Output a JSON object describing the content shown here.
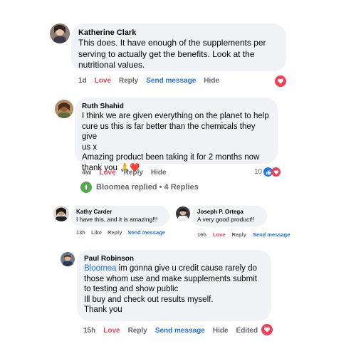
{
  "comments": [
    {
      "author": "Katherine Clark",
      "text": "This does. It have enough of the supplements per\nserving to actually get the benefits. Look at the\nnutritional values.",
      "time": "1d",
      "love": "Love",
      "reply": "Reply",
      "send": "Send message",
      "hide": "Hide",
      "reaction_icon": "heart-icon"
    },
    {
      "author": "Ruth Shahid",
      "text": "I think we are given everything on the planet to help\ncure us this is far better than the chemicals they give\nus x\nAmazing product been taking it for 2 months now\nthank you 🙏❤️",
      "time": "4w",
      "love": "Love",
      "reply": "Reply",
      "hide": "Hide",
      "reaction_count": "10",
      "reaction_icons": [
        "like-icon",
        "heart-icon"
      ]
    },
    {
      "author": "Kathy Carder",
      "text": "I have this, and it is amazing!!!",
      "time": "13h",
      "like": "Like",
      "reply": "Reply",
      "send": "Send message"
    },
    {
      "author": "Joseph P. Ortega",
      "text": "A very good product!!",
      "time": "16h",
      "love": "Love",
      "reply": "Reply",
      "send": "Send message"
    },
    {
      "author": "Paul Robinson",
      "mention": "Bloomea",
      "text": " im gonna give u credit cause rarely do\nthose whom use and make supplements submit\nto testing and show public\nIll buy and check out results myself.\nThank you",
      "time": "15h",
      "love": "Love",
      "reply": "Reply",
      "send": "Send message",
      "hide": "Hide",
      "edited": "Edited",
      "reaction_icon": "heart-icon"
    }
  ],
  "replies_summary": "Bloomea replied • 4 Replies",
  "colors": {
    "bubble": "#f0f2f5",
    "love": "#f33e58",
    "link": "#216fdb",
    "meta": "#65676b",
    "brand_green": "#58a84f"
  }
}
